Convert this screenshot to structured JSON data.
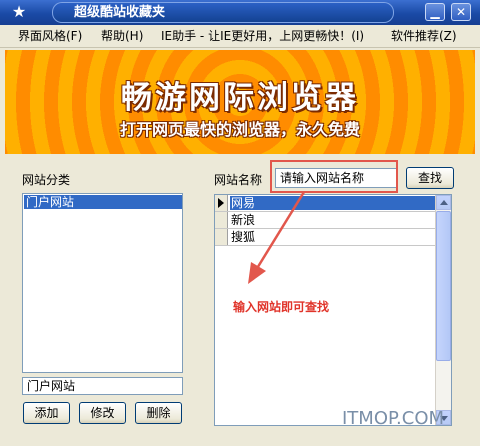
{
  "titlebar": {
    "title": "超级酷站收藏夹"
  },
  "menu": {
    "items": [
      "界面风格(F)",
      "帮助(H)",
      "IE助手 - 让IE更好用，上网更畅快！(I)",
      "软件推荐(Z)"
    ]
  },
  "banner": {
    "headline": "畅游网际浏览器",
    "tagline": "打开网页最快的浏览器，永久免费"
  },
  "left_panel": {
    "label": "网站分类",
    "categories": [
      "门户网站"
    ],
    "selected_index": 0,
    "name_value": "门户网站",
    "buttons": {
      "add": "添加",
      "edit": "修改",
      "delete": "删除"
    }
  },
  "right_panel": {
    "label": "网站名称",
    "search_placeholder": "请输入网站名称",
    "search_button": "查找",
    "sites": [
      "网易",
      "新浪",
      "搜狐"
    ],
    "selected_index": 0
  },
  "annotation": {
    "text": "输入网站即可查找"
  },
  "watermark": {
    "text": "ITMOP.COM"
  },
  "colors": {
    "accent": "#e2574c",
    "selection": "#316ac5",
    "title_bar": "#1a4aa6"
  }
}
